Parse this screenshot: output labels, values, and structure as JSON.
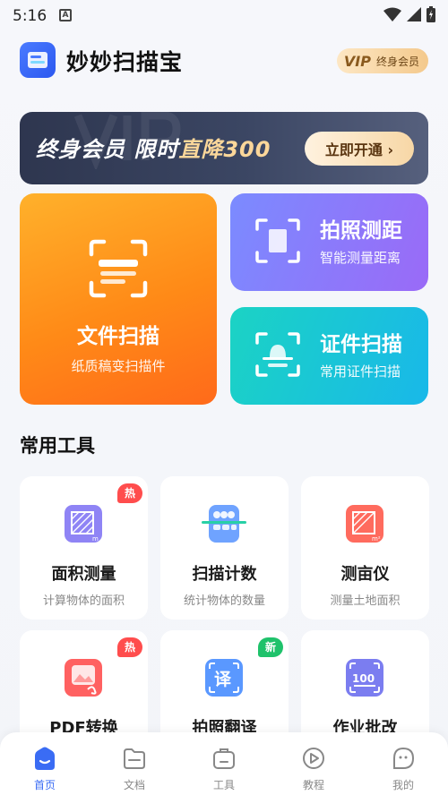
{
  "status_bar": {
    "time": "5:16",
    "notification_icon": "A"
  },
  "header": {
    "app_title": "妙妙扫描宝",
    "vip_mark": "VIP",
    "vip_text": "终身会员"
  },
  "banner": {
    "text_a": "终身会员 限时",
    "text_b": "直降300",
    "cta": "立即开通 ›"
  },
  "features": {
    "scan": {
      "title": "文件扫描",
      "subtitle": "纸质稿变扫描件"
    },
    "measure": {
      "title": "拍照测距",
      "subtitle": "智能测量距离"
    },
    "id": {
      "title": "证件扫描",
      "subtitle": "常用证件扫描"
    }
  },
  "tools_section": {
    "title": "常用工具"
  },
  "tools": [
    {
      "name": "面积测量",
      "subtitle": "计算物体的面积",
      "badge": "热"
    },
    {
      "name": "扫描计数",
      "subtitle": "统计物体的数量",
      "badge": ""
    },
    {
      "name": "测亩仪",
      "subtitle": "测量土地面积",
      "badge": ""
    },
    {
      "name": "PDF转换",
      "subtitle": "",
      "badge": "热"
    },
    {
      "name": "拍照翻译",
      "subtitle": "",
      "badge": "新"
    },
    {
      "name": "作业批改",
      "subtitle": "",
      "badge": ""
    }
  ],
  "nav": [
    {
      "label": "首页",
      "icon": "home-icon",
      "active": true
    },
    {
      "label": "文档",
      "icon": "folder-icon",
      "active": false
    },
    {
      "label": "工具",
      "icon": "toolbox-icon",
      "active": false
    },
    {
      "label": "教程",
      "icon": "play-icon",
      "active": false
    },
    {
      "label": "我的",
      "icon": "chat-face-icon",
      "active": false
    }
  ],
  "colors": {
    "accent": "#3a6cf4",
    "hot": "#ff4d4d",
    "new": "#1fc26b"
  }
}
